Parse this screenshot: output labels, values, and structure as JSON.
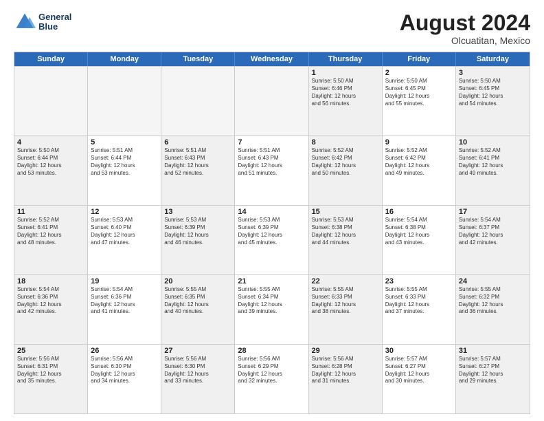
{
  "header": {
    "logo_line1": "General",
    "logo_line2": "Blue",
    "month_year": "August 2024",
    "location": "Olcuatitan, Mexico"
  },
  "weekdays": [
    "Sunday",
    "Monday",
    "Tuesday",
    "Wednesday",
    "Thursday",
    "Friday",
    "Saturday"
  ],
  "rows": [
    [
      {
        "day": "",
        "text": "",
        "empty": true
      },
      {
        "day": "",
        "text": "",
        "empty": true
      },
      {
        "day": "",
        "text": "",
        "empty": true
      },
      {
        "day": "",
        "text": "",
        "empty": true
      },
      {
        "day": "1",
        "text": "Sunrise: 5:50 AM\nSunset: 6:46 PM\nDaylight: 12 hours\nand 56 minutes.",
        "empty": false
      },
      {
        "day": "2",
        "text": "Sunrise: 5:50 AM\nSunset: 6:45 PM\nDaylight: 12 hours\nand 55 minutes.",
        "empty": false
      },
      {
        "day": "3",
        "text": "Sunrise: 5:50 AM\nSunset: 6:45 PM\nDaylight: 12 hours\nand 54 minutes.",
        "empty": false
      }
    ],
    [
      {
        "day": "4",
        "text": "Sunrise: 5:50 AM\nSunset: 6:44 PM\nDaylight: 12 hours\nand 53 minutes.",
        "empty": false
      },
      {
        "day": "5",
        "text": "Sunrise: 5:51 AM\nSunset: 6:44 PM\nDaylight: 12 hours\nand 53 minutes.",
        "empty": false
      },
      {
        "day": "6",
        "text": "Sunrise: 5:51 AM\nSunset: 6:43 PM\nDaylight: 12 hours\nand 52 minutes.",
        "empty": false
      },
      {
        "day": "7",
        "text": "Sunrise: 5:51 AM\nSunset: 6:43 PM\nDaylight: 12 hours\nand 51 minutes.",
        "empty": false
      },
      {
        "day": "8",
        "text": "Sunrise: 5:52 AM\nSunset: 6:42 PM\nDaylight: 12 hours\nand 50 minutes.",
        "empty": false
      },
      {
        "day": "9",
        "text": "Sunrise: 5:52 AM\nSunset: 6:42 PM\nDaylight: 12 hours\nand 49 minutes.",
        "empty": false
      },
      {
        "day": "10",
        "text": "Sunrise: 5:52 AM\nSunset: 6:41 PM\nDaylight: 12 hours\nand 49 minutes.",
        "empty": false
      }
    ],
    [
      {
        "day": "11",
        "text": "Sunrise: 5:52 AM\nSunset: 6:41 PM\nDaylight: 12 hours\nand 48 minutes.",
        "empty": false
      },
      {
        "day": "12",
        "text": "Sunrise: 5:53 AM\nSunset: 6:40 PM\nDaylight: 12 hours\nand 47 minutes.",
        "empty": false
      },
      {
        "day": "13",
        "text": "Sunrise: 5:53 AM\nSunset: 6:39 PM\nDaylight: 12 hours\nand 46 minutes.",
        "empty": false
      },
      {
        "day": "14",
        "text": "Sunrise: 5:53 AM\nSunset: 6:39 PM\nDaylight: 12 hours\nand 45 minutes.",
        "empty": false
      },
      {
        "day": "15",
        "text": "Sunrise: 5:53 AM\nSunset: 6:38 PM\nDaylight: 12 hours\nand 44 minutes.",
        "empty": false
      },
      {
        "day": "16",
        "text": "Sunrise: 5:54 AM\nSunset: 6:38 PM\nDaylight: 12 hours\nand 43 minutes.",
        "empty": false
      },
      {
        "day": "17",
        "text": "Sunrise: 5:54 AM\nSunset: 6:37 PM\nDaylight: 12 hours\nand 42 minutes.",
        "empty": false
      }
    ],
    [
      {
        "day": "18",
        "text": "Sunrise: 5:54 AM\nSunset: 6:36 PM\nDaylight: 12 hours\nand 42 minutes.",
        "empty": false
      },
      {
        "day": "19",
        "text": "Sunrise: 5:54 AM\nSunset: 6:36 PM\nDaylight: 12 hours\nand 41 minutes.",
        "empty": false
      },
      {
        "day": "20",
        "text": "Sunrise: 5:55 AM\nSunset: 6:35 PM\nDaylight: 12 hours\nand 40 minutes.",
        "empty": false
      },
      {
        "day": "21",
        "text": "Sunrise: 5:55 AM\nSunset: 6:34 PM\nDaylight: 12 hours\nand 39 minutes.",
        "empty": false
      },
      {
        "day": "22",
        "text": "Sunrise: 5:55 AM\nSunset: 6:33 PM\nDaylight: 12 hours\nand 38 minutes.",
        "empty": false
      },
      {
        "day": "23",
        "text": "Sunrise: 5:55 AM\nSunset: 6:33 PM\nDaylight: 12 hours\nand 37 minutes.",
        "empty": false
      },
      {
        "day": "24",
        "text": "Sunrise: 5:55 AM\nSunset: 6:32 PM\nDaylight: 12 hours\nand 36 minutes.",
        "empty": false
      }
    ],
    [
      {
        "day": "25",
        "text": "Sunrise: 5:56 AM\nSunset: 6:31 PM\nDaylight: 12 hours\nand 35 minutes.",
        "empty": false
      },
      {
        "day": "26",
        "text": "Sunrise: 5:56 AM\nSunset: 6:30 PM\nDaylight: 12 hours\nand 34 minutes.",
        "empty": false
      },
      {
        "day": "27",
        "text": "Sunrise: 5:56 AM\nSunset: 6:30 PM\nDaylight: 12 hours\nand 33 minutes.",
        "empty": false
      },
      {
        "day": "28",
        "text": "Sunrise: 5:56 AM\nSunset: 6:29 PM\nDaylight: 12 hours\nand 32 minutes.",
        "empty": false
      },
      {
        "day": "29",
        "text": "Sunrise: 5:56 AM\nSunset: 6:28 PM\nDaylight: 12 hours\nand 31 minutes.",
        "empty": false
      },
      {
        "day": "30",
        "text": "Sunrise: 5:57 AM\nSunset: 6:27 PM\nDaylight: 12 hours\nand 30 minutes.",
        "empty": false
      },
      {
        "day": "31",
        "text": "Sunrise: 5:57 AM\nSunset: 6:27 PM\nDaylight: 12 hours\nand 29 minutes.",
        "empty": false
      }
    ]
  ]
}
